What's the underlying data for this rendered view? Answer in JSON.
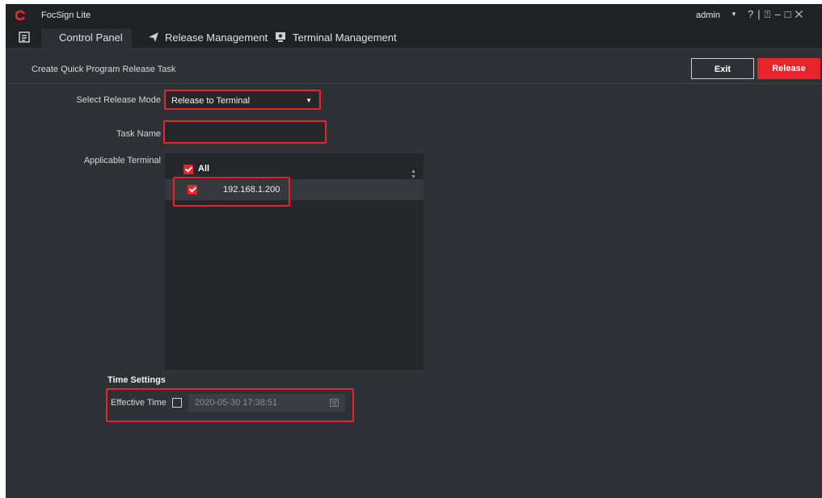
{
  "titlebar": {
    "app_title": "FocSign Lite",
    "user": "admin",
    "user_caret": "▼",
    "icons": [
      "help-icon",
      "lock-icon",
      "minimize-icon",
      "maximize-icon",
      "close-icon"
    ]
  },
  "nav": {
    "tabs": [
      {
        "label": "Control Panel",
        "icon": "control-panel-icon",
        "active": true
      },
      {
        "label": "Release Management",
        "icon": "send-icon",
        "active": false
      },
      {
        "label": "Terminal Management",
        "icon": "monitor-icon",
        "active": false
      }
    ]
  },
  "header": {
    "title": "Create Quick Program Release Task",
    "exit_label": "Exit",
    "release_label": "Release"
  },
  "form": {
    "release_mode_label": "Select Release Mode",
    "release_mode_value": "Release to Terminal",
    "task_name_label": "Task Name",
    "task_name_value": "",
    "terminal_label": "Applicable Terminal",
    "terminal_all_label": "All",
    "terminals": [
      {
        "ip": "192.168.1.200",
        "checked": true
      }
    ],
    "time_settings_label": "Time Settings",
    "effective_time_label": "Effective Time",
    "effective_time_checked": false,
    "effective_time_value": "2020-05-30 17:38:51"
  },
  "colors": {
    "accent": "#e8232a",
    "background": "#2e3136",
    "panel": "#24262a",
    "titlebar": "#1f2125"
  }
}
